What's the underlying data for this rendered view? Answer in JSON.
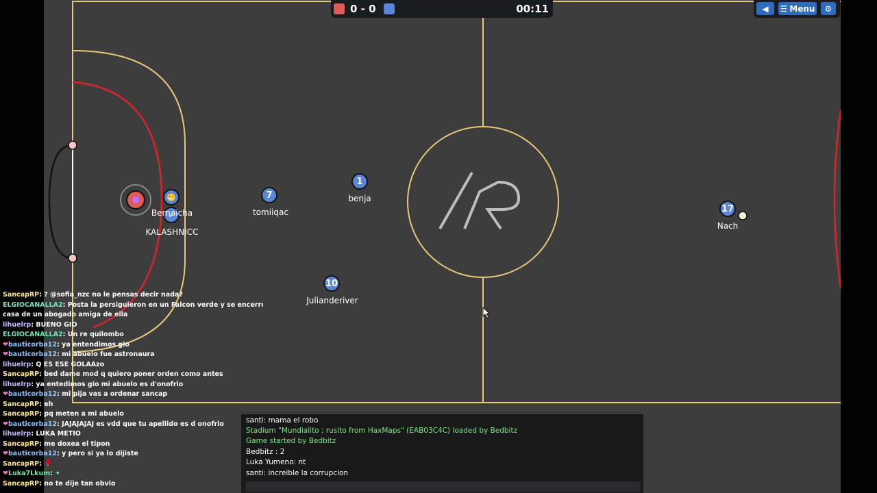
{
  "scoreboard": {
    "score": "0 - 0",
    "timer": "00:11",
    "red_color": "#e05a5a",
    "blue_color": "#5a86d8"
  },
  "top_controls": {
    "sound_icon": "speaker-icon",
    "menu_label": "Menu",
    "settings_icon": "gear-icon"
  },
  "players": [
    {
      "number": "7",
      "name": "tomiiqac"
    },
    {
      "number": "1",
      "name": "benja"
    },
    {
      "number": "10",
      "name": "Julianderiver"
    },
    {
      "number": "17",
      "name": "Nach"
    },
    {
      "number": "",
      "name": "Bernaicha"
    },
    {
      "number": "",
      "name": "KALASHNICC"
    }
  ],
  "room_chat": [
    {
      "user": "SancapRP",
      "text": "? @sofia_nzc no le pensas decir nada?"
    },
    {
      "user": "ELGIOCANALLA2",
      "text": "Posta la persiguieron en un Falcon verde y se encerró en la"
    },
    {
      "user": "",
      "text": "casa de un abogado amiga de ella"
    },
    {
      "user": "lihuelrp",
      "text": "BUENO GIO"
    },
    {
      "user": "ELGIOCANALLA2",
      "text": "Un re quilombo"
    },
    {
      "user": "bauticorba12",
      "text": "ya entendimos gio"
    },
    {
      "user": "bauticorba12",
      "text": "mi abuelo fue astronaura"
    },
    {
      "user": "lihuelrp",
      "text": "Q ES ESE GOLAAzo"
    },
    {
      "user": "SancapRP",
      "text": "bed dame mod q quiero poner orden como antes"
    },
    {
      "user": "lihuelrp",
      "text": "ya entedimos gio mi abuelo es d'onofrio"
    },
    {
      "user": "bauticorba12",
      "text": "mi pija vas a ordenar sancap"
    },
    {
      "user": "SancapRP",
      "text": "eh"
    },
    {
      "user": "SancapRP",
      "text": "pq meten a mi abuelo"
    },
    {
      "user": "bauticorba12",
      "text": "JAJAJAJAJ es vdd que tu apellido es d onofrio"
    },
    {
      "user": "lihuelrp",
      "text": "LUKA METIO"
    },
    {
      "user": "SancapRP",
      "text": "me doxea el tipon"
    },
    {
      "user": "bauticorba12",
      "text": "y pero si ya lo dijiste"
    },
    {
      "user": "SancapRP",
      "text": ""
    },
    {
      "user": "Luka7Lkum",
      "text": ""
    },
    {
      "user": "SancapRP",
      "text": "no te dije tan obvio"
    }
  ],
  "console": {
    "line1": "santi: mama el robo",
    "line2": "Stadium \"Mundialito ; rusito from HaxMaps\" (EAB03C4C) loaded by Bedbitz",
    "line3": "Game started by Bedbitz",
    "line4": "Bedbitz : 2",
    "line5": "Luka Yumeno: nt",
    "line6": "santi: increible la corrupcion"
  },
  "colors": {
    "field": "#3d3d3e",
    "lines": "#e8c97a",
    "red_area": "#d8242b",
    "blue_player": "#5a86d8"
  }
}
